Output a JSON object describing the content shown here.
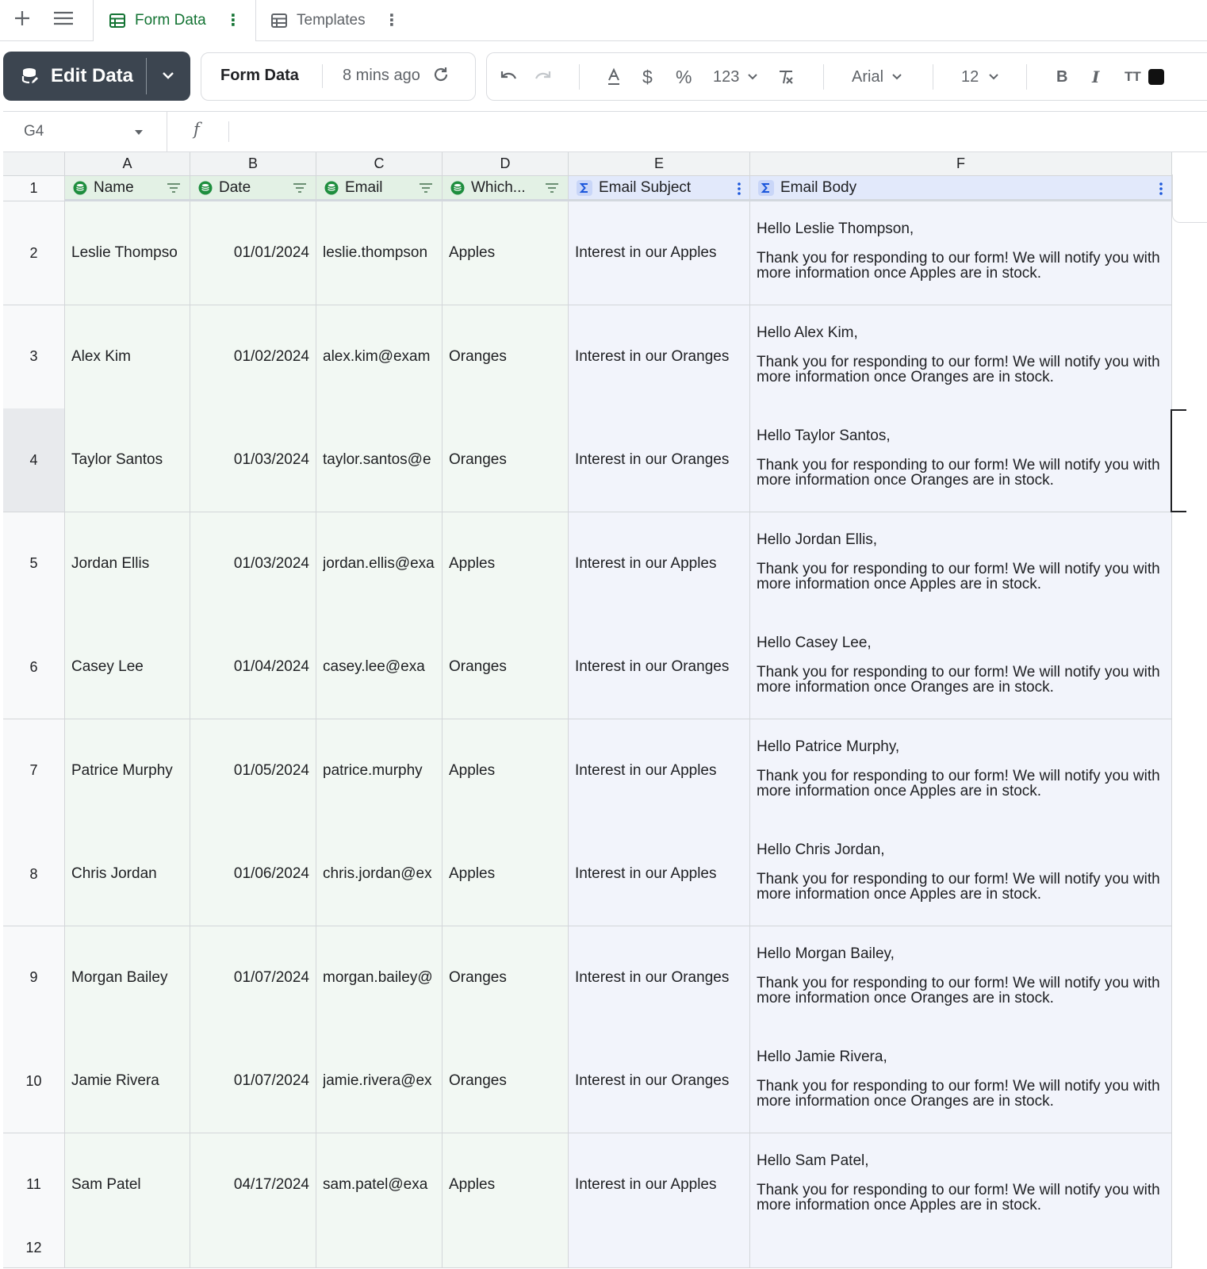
{
  "tabs": [
    {
      "label": "Form Data",
      "active": true
    },
    {
      "label": "Templates",
      "active": false
    }
  ],
  "toolbar": {
    "edit_label": "Edit Data",
    "sheet_name": "Form Data",
    "last_saved": "8 mins ago",
    "number_format": "123",
    "font": "Arial",
    "font_size": "12",
    "bold": "B",
    "italic": "I",
    "text_size": "TT"
  },
  "formula_bar": {
    "cell_ref": "G4",
    "fx": "f",
    "formula": ""
  },
  "columns": [
    "A",
    "B",
    "C",
    "D",
    "E",
    "F"
  ],
  "header_row": {
    "number": "1",
    "fields": [
      {
        "label": "Name",
        "kind": "data"
      },
      {
        "label": "Date",
        "kind": "data"
      },
      {
        "label": "Email",
        "kind": "data"
      },
      {
        "label": "Which...",
        "kind": "data"
      },
      {
        "label": "Email Subject",
        "kind": "formula"
      },
      {
        "label": "Email Body",
        "kind": "formula"
      }
    ]
  },
  "rows": [
    {
      "n": "2",
      "name": "Leslie Thompso",
      "date": "01/01/2024",
      "email": "leslie.thompson",
      "which": "Apples",
      "subject": "Interest in our Apples",
      "greeting": "Hello Leslie Thompson,",
      "body": "Thank you for responding to our form! We will notify you with more information once Apples are in stock."
    },
    {
      "n": "3",
      "name": "Alex Kim",
      "date": "01/02/2024",
      "email": "alex.kim@exam",
      "which": "Oranges",
      "subject": "Interest in our Oranges",
      "greeting": "Hello Alex Kim,",
      "body": "Thank you for responding to our form! We will notify you with more information once Oranges are in stock."
    },
    {
      "n": "4",
      "name": "Taylor Santos",
      "date": "01/03/2024",
      "email": "taylor.santos@e",
      "which": "Oranges",
      "subject": "Interest in our Oranges",
      "greeting": "Hello Taylor Santos,",
      "body": "Thank you for responding to our form! We will notify you with more information once Oranges are in stock."
    },
    {
      "n": "5",
      "name": "Jordan Ellis",
      "date": "01/03/2024",
      "email": "jordan.ellis@exa",
      "which": "Apples",
      "subject": "Interest in our Apples",
      "greeting": "Hello Jordan Ellis,",
      "body": "Thank you for responding to our form! We will notify you with more information once Apples are in stock."
    },
    {
      "n": "6",
      "name": "Casey Lee",
      "date": "01/04/2024",
      "email": "casey.lee@exa",
      "which": "Oranges",
      "subject": "Interest in our Oranges",
      "greeting": "Hello Casey Lee,",
      "body": "Thank you for responding to our form! We will notify you with more information once Oranges are in stock."
    },
    {
      "n": "7",
      "name": "Patrice Murphy",
      "date": "01/05/2024",
      "email": "patrice.murphy",
      "which": "Apples",
      "subject": "Interest in our Apples",
      "greeting": "Hello Patrice Murphy,",
      "body": "Thank you for responding to our form! We will notify you with more information once Apples are in stock."
    },
    {
      "n": "8",
      "name": "Chris Jordan",
      "date": "01/06/2024",
      "email": "chris.jordan@ex",
      "which": "Apples",
      "subject": "Interest in our Apples",
      "greeting": "Hello Chris Jordan,",
      "body": "Thank you for responding to our form! We will notify you with more information once Apples are in stock."
    },
    {
      "n": "9",
      "name": "Morgan Bailey",
      "date": "01/07/2024",
      "email": "morgan.bailey@",
      "which": "Oranges",
      "subject": "Interest in our Oranges",
      "greeting": "Hello Morgan Bailey,",
      "body": "Thank you for responding to our form! We will notify you with more information once Oranges are in stock."
    },
    {
      "n": "10",
      "name": "Jamie Rivera",
      "date": "01/07/2024",
      "email": "jamie.rivera@ex",
      "which": "Oranges",
      "subject": "Interest in our Oranges",
      "greeting": "Hello Jamie Rivera,",
      "body": "Thank you for responding to our form! We will notify you with more information once Oranges are in stock."
    },
    {
      "n": "11",
      "name": "Sam Patel",
      "date": "04/17/2024",
      "email": "sam.patel@exa",
      "which": "Apples",
      "subject": "Interest in our Apples",
      "greeting": "Hello Sam Patel,",
      "body": "Thank you for responding to our form! We will notify you with more information once Apples are in stock."
    }
  ],
  "partial_row_number": "12",
  "selected_row": "4",
  "colors": {
    "data_column": "#f2f8f3",
    "formula_column": "#f2f4fb",
    "accent_green": "#137333",
    "accent_blue": "#1a56db",
    "edit_button": "#3c4550"
  }
}
